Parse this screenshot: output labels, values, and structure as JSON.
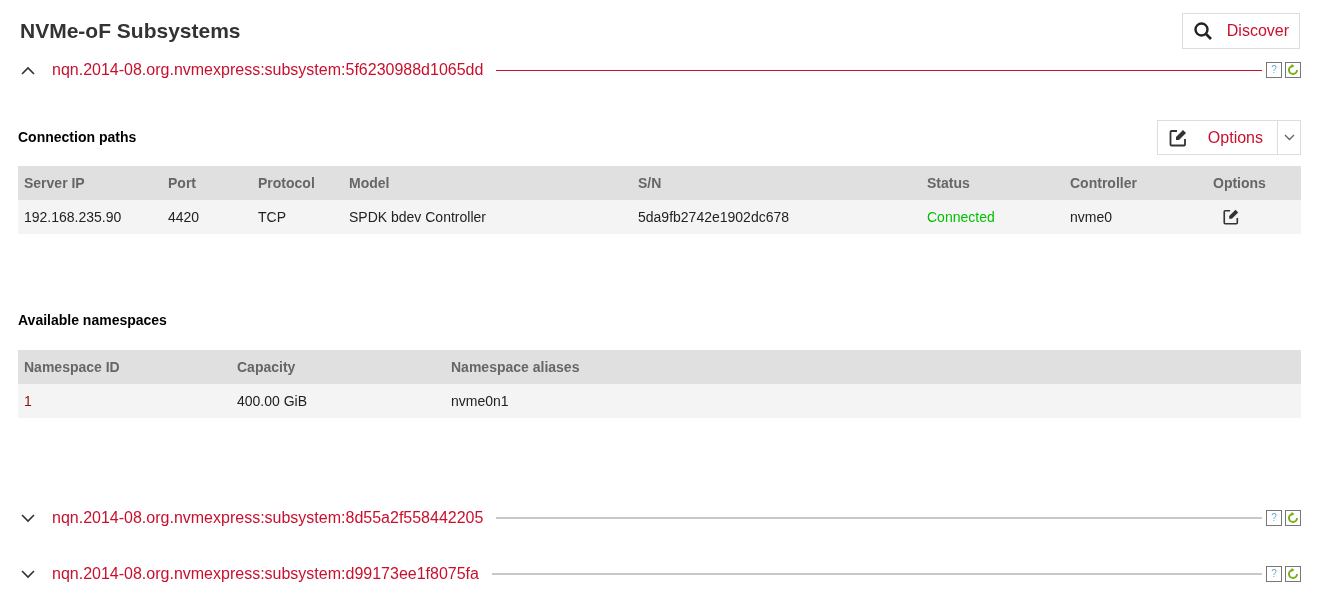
{
  "title": "NVMe-oF Subsystems",
  "discover_button": "Discover",
  "subsystems": [
    {
      "name": "nqn.2014-08.org.nvmexpress:subsystem:5f6230988d1065dd",
      "expanded": true,
      "help": "?",
      "connection_paths": {
        "heading": "Connection paths",
        "options_button": "Options",
        "columns": [
          "Server IP",
          "Port",
          "Protocol",
          "Model",
          "S/N",
          "Status",
          "Controller",
          "Options"
        ],
        "rows": [
          [
            {
              "kind": "text",
              "text": "192.168.235.90"
            },
            {
              "kind": "text",
              "text": "4420"
            },
            {
              "kind": "text",
              "text": "TCP"
            },
            {
              "kind": "text",
              "text": "SPDK bdev Controller"
            },
            {
              "kind": "text",
              "text": "5da9fb2742e1902dc678"
            },
            {
              "kind": "status",
              "text": "Connected"
            },
            {
              "kind": "text",
              "text": "nvme0"
            },
            {
              "kind": "edit"
            }
          ]
        ]
      },
      "namespaces": {
        "heading": "Available namespaces",
        "columns": [
          "Namespace ID",
          "Capacity",
          "Namespace aliases"
        ],
        "rows": [
          [
            {
              "kind": "link",
              "text": "1"
            },
            {
              "kind": "text",
              "text": "400.00 GiB"
            },
            {
              "kind": "text",
              "text": "nvme0n1"
            }
          ]
        ]
      }
    },
    {
      "name": "nqn.2014-08.org.nvmexpress:subsystem:8d55a2f558442205",
      "expanded": false,
      "help": "?"
    },
    {
      "name": "nqn.2014-08.org.nvmexpress:subsystem:d99173ee1f8075fa",
      "expanded": false,
      "help": "?"
    }
  ]
}
